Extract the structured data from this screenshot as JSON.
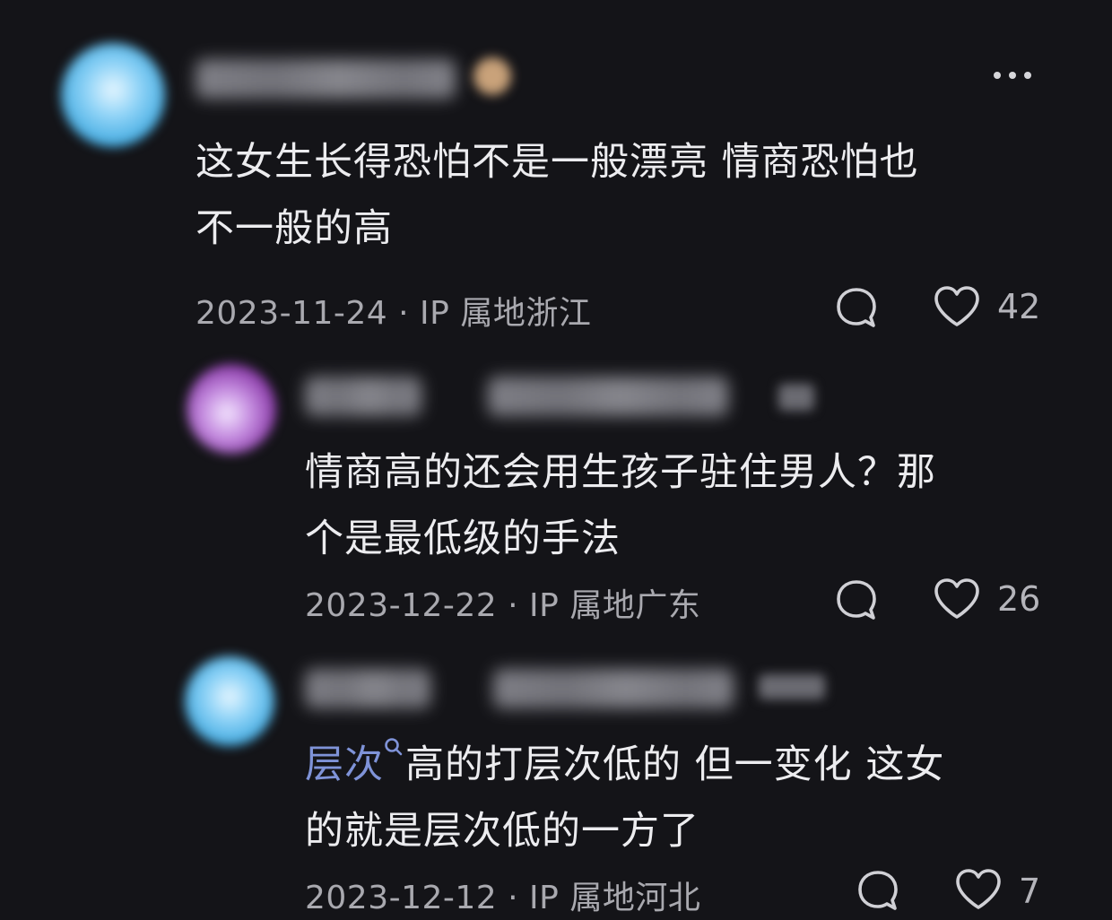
{
  "comments": [
    {
      "text_line1": "这女生长得恐怕不是一般漂亮 情商恐怕也",
      "text_line2": "不一般的高",
      "date": "2023-11-24",
      "ip_location": "· IP 属地浙江",
      "likes": "42",
      "avatar_color": "#3fa9e0"
    },
    {
      "text_line1": "情商高的还会用生孩子驻住男人？那",
      "text_line2": "个是最低级的手法",
      "date": "2023-12-22",
      "ip_location": "· IP 属地广东",
      "likes": "26",
      "avatar_color": "#8a3aa8"
    },
    {
      "link_word": "层次",
      "text_line1_rest": "高的打层次低的 但一变化 这女",
      "text_line2": "的就是层次低的一方了",
      "date": "2023-12-12",
      "ip_location": "· IP 属地河北",
      "likes": "7",
      "avatar_color": "#3fa9e0"
    }
  ],
  "icons": {
    "more": "more-icon",
    "reply": "reply-bubble-icon",
    "like": "heart-icon",
    "search": "search-icon"
  },
  "colors": {
    "background": "#141418",
    "text": "#ececef",
    "meta": "#a9a9af",
    "link": "#7f93d8"
  }
}
